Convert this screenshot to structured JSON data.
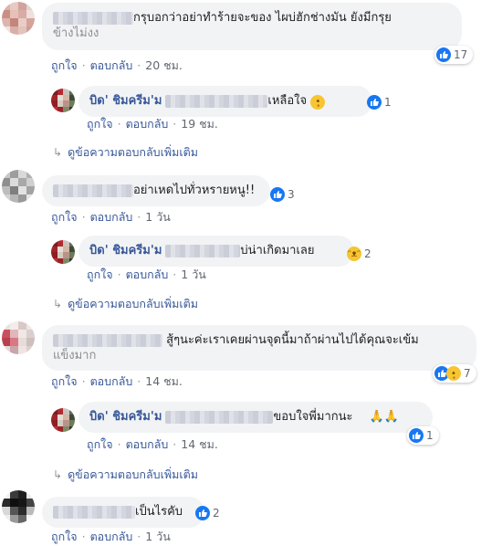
{
  "comments": [
    {
      "text": "กรุบอกว่าอย่าทำร้ายจะของ ไผบ่ฮักช่างมัน ยังมีกรุย",
      "text_line2": "ข้างไม่งง",
      "reaction_count": "17",
      "actions": {
        "like": "ถูกใจ",
        "reply": "ตอบกลับ",
        "time": "20 ชม."
      },
      "reply": {
        "author": "บิด' ชิมครีม'ม",
        "text": "ุเหลือใจ",
        "reaction_count": "1",
        "actions": {
          "like": "ถูกใจ",
          "reply": "ตอบกลับ",
          "time": "19 ชม."
        }
      },
      "more_replies": "ดูข้อความตอบกลับเพิ่มเติม"
    },
    {
      "text": "อย่าเหดไปทั่วหรายหนู!!",
      "reaction_count": "3",
      "actions": {
        "like": "ถูกใจ",
        "reply": "ตอบกลับ",
        "time": "1 วัน"
      },
      "reply": {
        "author": "บิด' ชิมครีม'ม",
        "text": "บ่น่าเกิดมาเลย",
        "reaction_count": "2",
        "actions": {
          "like": "ถูกใจ",
          "reply": "ตอบกลับ",
          "time": "1 วัน"
        }
      },
      "more_replies": "ดูข้อความตอบกลับเพิ่มเติม"
    },
    {
      "text": "สู้ๆนะค่ะเราเคยผ่านจุดนี้มาถ้าผ่านไปได้คุณจะเข้ม",
      "text_line2": "แข็งมาก",
      "reaction_count": "7",
      "actions": {
        "like": "ถูกใจ",
        "reply": "ตอบกลับ",
        "time": "14 ชม."
      },
      "reply": {
        "author": "บิด' ชิมครีม'ม",
        "text": "ขอบใจพี่มากนะ",
        "reaction_count": "1",
        "actions": {
          "like": "ถูกใจ",
          "reply": "ตอบกลับ",
          "time": "14 ชม."
        }
      },
      "more_replies": "ดูข้อความตอบกลับเพิ่มเติม"
    },
    {
      "text": "เป็นไรคับ",
      "reaction_count": "2",
      "actions": {
        "like": "ถูกใจ",
        "reply": "ตอบกลับ",
        "time": "1 วัน"
      }
    }
  ],
  "icons": {
    "like": "thumbs-up-icon",
    "haha": "laughing-emoji-icon",
    "sad": "sad-emoji-icon",
    "pray": "praying-hands-icon",
    "arrow": "reply-arrow-icon"
  },
  "colors": {
    "link": "#385898",
    "meta": "#616770",
    "bubble": "#f2f3f5",
    "like": "#1877f2"
  }
}
